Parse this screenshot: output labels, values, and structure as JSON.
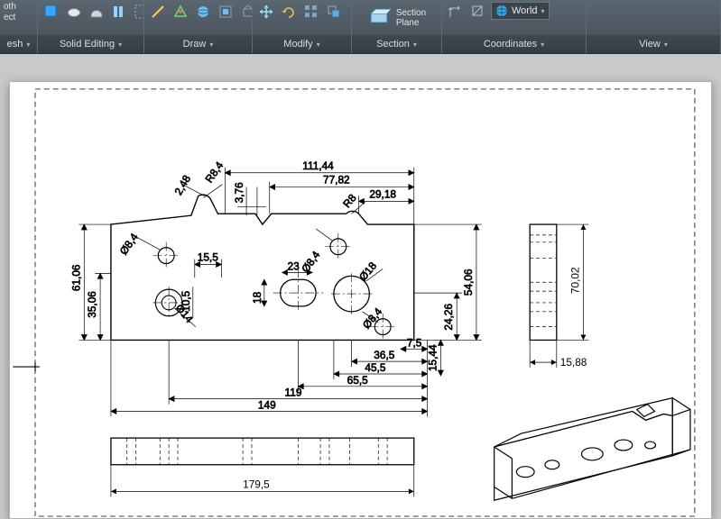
{
  "ribbon": {
    "panels": {
      "mesh": {
        "title": "esh",
        "labels": [
          "oth",
          "ect"
        ]
      },
      "solid_editing": {
        "title": "Solid Editing"
      },
      "draw": {
        "title": "Draw"
      },
      "modify": {
        "title": "Modify"
      },
      "section": {
        "title": "Section",
        "section_plane_label": "Section\nPlane"
      },
      "coordinates": {
        "title": "Coordinates",
        "world_label": "World"
      },
      "view": {
        "title": "View"
      }
    }
  },
  "drawing": {
    "dims": {
      "d111_44": "111,44",
      "d77_82": "77,82",
      "d29_18": "29,18",
      "d2_48": "2,48",
      "d3_76": "3,76",
      "r8_4": "R8,4",
      "r8": "R8",
      "d61_06": "61,06",
      "d35_06": "35,06",
      "d15_5": "15,5",
      "d10_5": "10,5",
      "d18": "18",
      "d23": "23",
      "phi8_4a": "Ø8,4",
      "phi8_4b": "Ø8,4",
      "phi8_4c": "Ø8,4",
      "phi18": "Ø18",
      "phi14": "Ø14",
      "d54_06": "54,06",
      "d24_26": "24,26",
      "d15_44": "15,44",
      "d7_5": "7,5",
      "d36_5": "36,5",
      "d45_5": "45,5",
      "d65_5": "65,5",
      "d119": "119",
      "d149": "149",
      "d179_5": "179,5",
      "d70_02": "70,02",
      "d15_88": "15,88"
    }
  }
}
